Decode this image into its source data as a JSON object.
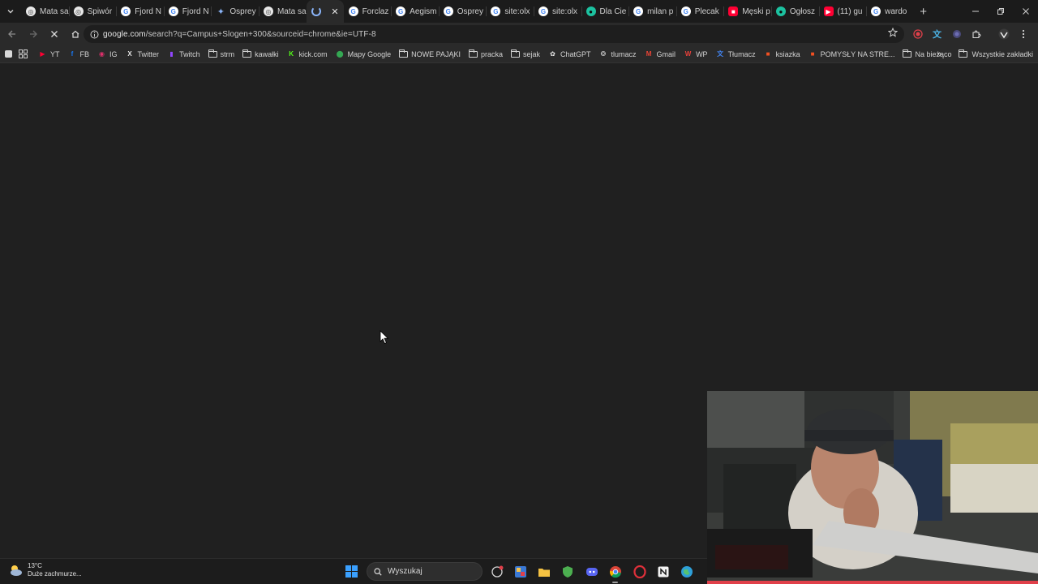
{
  "tabs": [
    {
      "title": "Mata sa",
      "icon": "generic-page-icon",
      "active": false
    },
    {
      "title": "Śpiwór",
      "icon": "generic-page-icon",
      "active": false
    },
    {
      "title": "Fjord N",
      "icon": "google-icon",
      "active": false
    },
    {
      "title": "Fjord N",
      "icon": "google-icon",
      "active": false
    },
    {
      "title": "Osprey",
      "icon": "gemini-icon",
      "active": false
    },
    {
      "title": "Mata sa",
      "icon": "generic-page-icon",
      "active": false
    },
    {
      "title": "",
      "icon": "loading-spinner-icon",
      "active": true
    },
    {
      "title": "Forclaz",
      "icon": "google-icon",
      "active": false
    },
    {
      "title": "Aegism",
      "icon": "google-icon",
      "active": false
    },
    {
      "title": "Osprey",
      "icon": "google-icon",
      "active": false
    },
    {
      "title": "site:olx",
      "icon": "google-icon",
      "active": false
    },
    {
      "title": "site:olx",
      "icon": "google-icon",
      "active": false
    },
    {
      "title": "Dla Cie",
      "icon": "teal-site-icon",
      "active": false
    },
    {
      "title": "milan p",
      "icon": "google-icon",
      "active": false
    },
    {
      "title": "Plecak",
      "icon": "google-icon",
      "active": false
    },
    {
      "title": "Męski p",
      "icon": "red-site-icon",
      "active": false
    },
    {
      "title": "Ogłosz",
      "icon": "teal-site-icon",
      "active": false
    },
    {
      "title": "(11) gu",
      "icon": "youtube-icon",
      "active": false
    },
    {
      "title": "wardo",
      "icon": "google-icon",
      "active": false
    }
  ],
  "address_bar": {
    "host": "google.com",
    "path": "/search?q=Campus+Slogen+300&sourceid=chrome&ie=UTF-8"
  },
  "bookmarks": [
    {
      "label": "YT",
      "icon": "youtube-icon",
      "color": "#ff0033"
    },
    {
      "label": "FB",
      "icon": "facebook-icon",
      "color": "#1877f2"
    },
    {
      "label": "IG",
      "icon": "instagram-icon",
      "color": "#e1306c"
    },
    {
      "label": "Twitter",
      "icon": "x-icon",
      "color": "#e8e8e8"
    },
    {
      "label": "Twitch",
      "icon": "twitch-icon",
      "color": "#9146ff"
    },
    {
      "label": "strm",
      "icon": "folder-icon",
      "color": ""
    },
    {
      "label": "kawałki",
      "icon": "folder-icon",
      "color": ""
    },
    {
      "label": "kick.com",
      "icon": "kick-icon",
      "color": "#53fc18"
    },
    {
      "label": "Mapy Google",
      "icon": "maps-pin-icon",
      "color": "#34a853"
    },
    {
      "label": "NOWE PAJĄKI",
      "icon": "folder-icon",
      "color": ""
    },
    {
      "label": "pracka",
      "icon": "folder-icon",
      "color": ""
    },
    {
      "label": "sejak",
      "icon": "folder-icon",
      "color": ""
    },
    {
      "label": "ChatGPT",
      "icon": "chatgpt-icon",
      "color": "#e8e8e8"
    },
    {
      "label": "tlumacz",
      "icon": "deepl-icon",
      "color": "#cfcfcf"
    },
    {
      "label": "Gmail",
      "icon": "gmail-icon",
      "color": "#ea4335"
    },
    {
      "label": "WP",
      "icon": "wp-icon",
      "color": "#e8403a"
    },
    {
      "label": "Tłumacz",
      "icon": "google-translate-icon",
      "color": "#4285f4"
    },
    {
      "label": "ksiazka",
      "icon": "microsoft-icon",
      "color": "#f25022"
    },
    {
      "label": "POMYSŁY NA STRE...",
      "icon": "microsoft-icon",
      "color": "#f25022"
    },
    {
      "label": "Na bieżąco",
      "icon": "folder-icon",
      "color": ""
    }
  ],
  "bookmarks_all_label": "Wszystkie zakładki",
  "taskbar": {
    "weather_temp": "13°C",
    "weather_desc": "Duże zachmurze...",
    "search_placeholder": "Wyszukaj"
  },
  "colors": {
    "page_background": "#202020",
    "tab_strip": "#1b1b1b",
    "toolbar": "#2a2a2a",
    "accent_blue": "#8ab4f8"
  }
}
